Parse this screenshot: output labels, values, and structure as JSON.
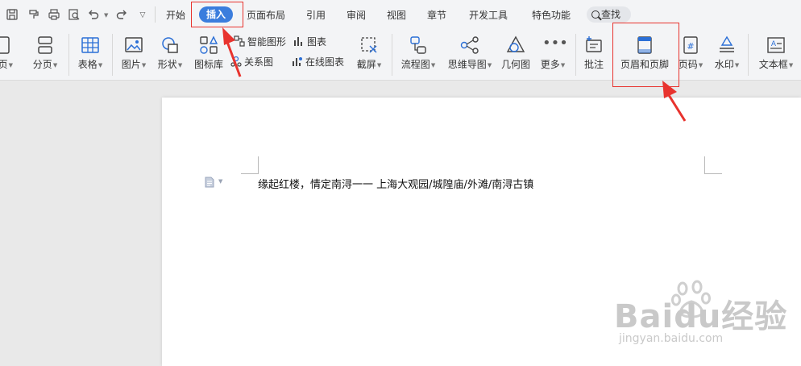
{
  "menu": {
    "tabs": [
      {
        "label": "开始"
      },
      {
        "label": "插入"
      },
      {
        "label": "页面布局"
      },
      {
        "label": "引用"
      },
      {
        "label": "审阅"
      },
      {
        "label": "视图"
      },
      {
        "label": "章节"
      },
      {
        "label": "开发工具"
      },
      {
        "label": "特色功能"
      }
    ],
    "search_label": "查找"
  },
  "ribbon": {
    "cover": "封面页",
    "pagebreak": "分页",
    "table": "表格",
    "picture": "图片",
    "shape": "形状",
    "iconlib": "图标库",
    "smartart": "智能图形",
    "chart": "图表",
    "relation": "关系图",
    "onlinechart": "在线图表",
    "screenshot": "截屏",
    "flowchart": "流程图",
    "mindmap": "思维导图",
    "geometry": "几何图",
    "more": "更多",
    "comment": "批注",
    "headerfooter": "页眉和页脚",
    "pagenum": "页码",
    "watermark": "水印",
    "textbox": "文本框"
  },
  "document": {
    "line1": "缘起红楼，情定南浔一一  上海大观园/城隍庙/外滩/南浔古镇"
  },
  "watermark": {
    "brand": "Baidu经验",
    "url": "jingyan.baidu.com"
  },
  "colors": {
    "accent": "#3b7ddd",
    "annotation": "#e8332e"
  }
}
